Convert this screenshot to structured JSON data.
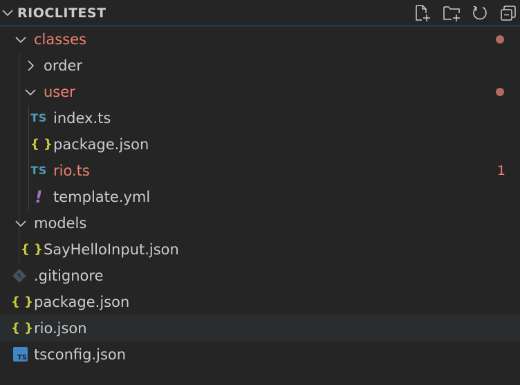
{
  "explorer": {
    "title": "RIOCLITEST",
    "actions": [
      {
        "name": "new-file-icon"
      },
      {
        "name": "new-folder-icon"
      },
      {
        "name": "refresh-icon"
      },
      {
        "name": "collapse-all-icon"
      }
    ]
  },
  "tree": {
    "classes": "classes",
    "order": "order",
    "user": "user",
    "index_ts": "index.ts",
    "user_package_json": "package.json",
    "rio_ts": "rio.ts",
    "rio_ts_problems": "1",
    "template_yml": "template.yml",
    "models": "models",
    "say_hello_input": "SayHelloInput.json",
    "gitignore": ".gitignore",
    "package_json": "package.json",
    "rio_json": "rio.json",
    "tsconfig_json": "tsconfig.json"
  },
  "icons": {
    "ts_label": "TS",
    "json_label": "{ }",
    "yml_label": "!"
  },
  "colors": {
    "background": "#252526",
    "modified_text": "#f0816e",
    "modified_dot": "#b26b63",
    "ts_icon": "#519aba",
    "json_icon": "#cbcb41",
    "yml_icon": "#a074c4",
    "focus_border": "#0e639c"
  }
}
